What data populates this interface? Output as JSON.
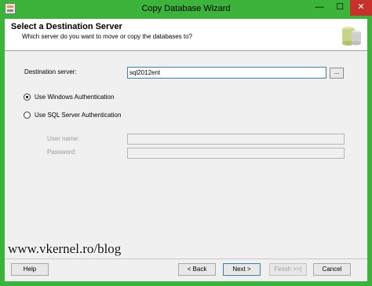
{
  "window": {
    "title": "Copy Database Wizard",
    "min_glyph": "—",
    "max_glyph": "☐",
    "close_glyph": "✕"
  },
  "header": {
    "title": "Select a Destination Server",
    "subtitle": "Which server do you want to move or copy the databases to?"
  },
  "form": {
    "destination_label": "Destination server:",
    "destination_value": "sql2012ent",
    "browse_label": "...",
    "auth_windows_label": "Use Windows Authentication",
    "auth_sql_label": "Use SQL Server Authentication",
    "auth_selected": "windows",
    "username_label": "User name:",
    "username_value": "",
    "password_label": "Password:",
    "password_value": ""
  },
  "watermark": "www.vkernel.ro/blog",
  "buttons": {
    "help": "Help",
    "back": "< Back",
    "next": "Next >",
    "finish": "Finish >>|",
    "cancel": "Cancel"
  },
  "colors": {
    "window_frame": "#3cb43c",
    "close_button": "#c7302b",
    "dialog_background": "#f0f0f0"
  }
}
